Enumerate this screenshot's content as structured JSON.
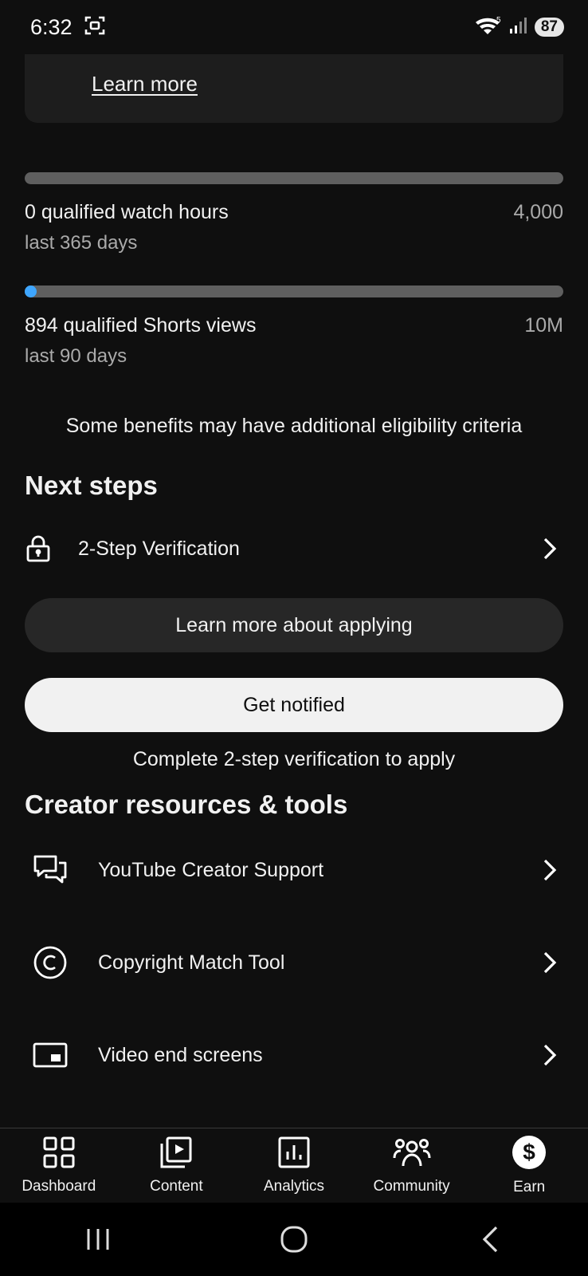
{
  "status_bar": {
    "time": "6:32",
    "battery": "87",
    "icons": [
      "screenshot-icon",
      "wifi-icon",
      "signal-icon",
      "battery-icon"
    ]
  },
  "info_card": {
    "link": "Learn more"
  },
  "watch_hours": {
    "label": "0 qualified watch hours",
    "target": "4,000",
    "period": "last 365 days",
    "progress": 0
  },
  "shorts_views": {
    "label": "894 qualified Shorts views",
    "target": "10M",
    "period": "last 90 days",
    "progress": 8.94e-05
  },
  "benefits_note": "Some benefits may have additional eligibility criteria",
  "next_steps": {
    "title": "Next steps",
    "items": [
      {
        "label": "2-Step Verification",
        "icon": "lock-icon"
      }
    ]
  },
  "buttons": {
    "learn_more_applying": "Learn more about applying",
    "get_notified": "Get notified"
  },
  "apply_note": "Complete 2-step verification to apply",
  "resources": {
    "title": "Creator resources & tools",
    "items": [
      {
        "label": "YouTube Creator Support",
        "icon": "chat-bubbles-icon"
      },
      {
        "label": "Copyright Match Tool",
        "icon": "copyright-icon"
      },
      {
        "label": "Video end screens",
        "icon": "end-screen-icon"
      }
    ]
  },
  "bottom_nav": {
    "items": [
      {
        "label": "Dashboard",
        "icon": "dashboard-icon"
      },
      {
        "label": "Content",
        "icon": "content-icon"
      },
      {
        "label": "Analytics",
        "icon": "analytics-icon"
      },
      {
        "label": "Community",
        "icon": "community-icon"
      },
      {
        "label": "Earn",
        "icon": "earn-icon",
        "active": true
      }
    ]
  },
  "colors": {
    "background": "#0f0f0f",
    "card": "#1d1d1d",
    "accent": "#3ea6ff",
    "track": "#5f5f5f",
    "text": "#f1f1f1",
    "muted": "#aaaaaa"
  }
}
